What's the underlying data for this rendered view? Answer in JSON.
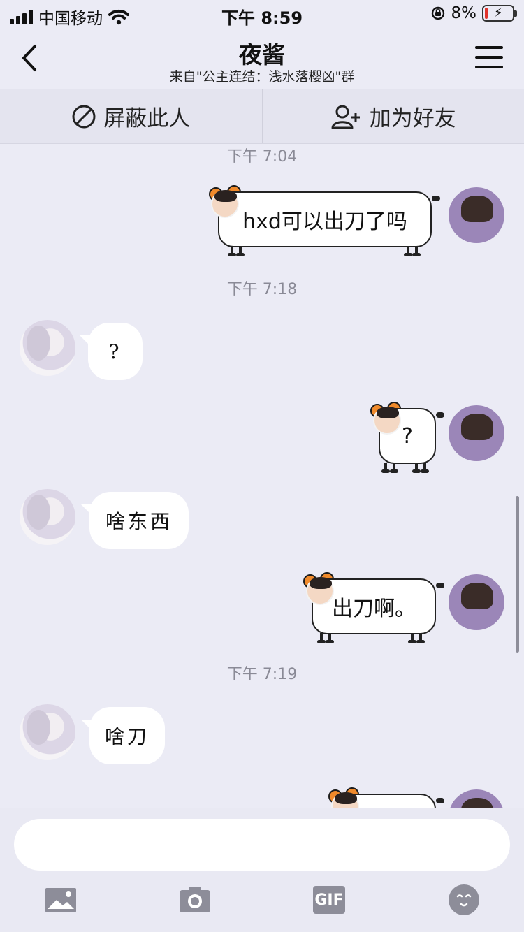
{
  "status_bar": {
    "carrier": "中国移动",
    "time": "下午 8:59",
    "battery_percent": "8%",
    "battery_level": 0.08
  },
  "nav": {
    "title": "夜酱",
    "subtitle": "来自\"公主连结：浅水落樱凶\"群"
  },
  "actions": {
    "block": "屏蔽此人",
    "add_friend": "加为好友"
  },
  "chat": {
    "timestamps": [
      "下午 7:04",
      "下午 7:18",
      "下午 7:19"
    ],
    "messages": [
      {
        "from": "me",
        "text": "hxd可以出刀了吗"
      },
      {
        "from": "other",
        "text": "?"
      },
      {
        "from": "me",
        "text": "?"
      },
      {
        "from": "other",
        "text": "啥东西"
      },
      {
        "from": "me",
        "text": "出刀啊。"
      },
      {
        "from": "other",
        "text": "啥刀"
      }
    ]
  },
  "input_bar": {
    "placeholder": "",
    "tools": [
      "image-icon",
      "camera-icon",
      "gif-icon",
      "emoji-icon"
    ],
    "gif_label": "GIF"
  },
  "colors": {
    "background": "#ebebf5",
    "sheep_ear": "#f08a2b",
    "battery_low": "#e0322b"
  }
}
